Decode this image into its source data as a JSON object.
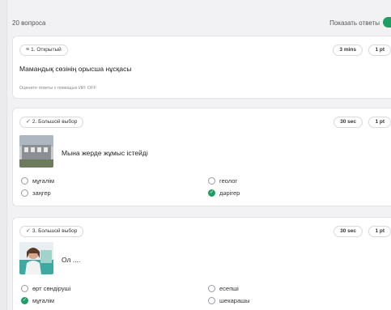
{
  "header": {
    "question_count": "20 вопроса",
    "show_answers_label": "Показать ответы",
    "show_answers_on": true
  },
  "questions": [
    {
      "number_type": "1. Открытый",
      "type_icon": "open-text-icon",
      "time": "3 mins",
      "points": "1 pt",
      "text": "Мамандық сөзінің орысша нұсқасы",
      "ai_note": "Оцените ответы с помощью ИИ: OFF"
    },
    {
      "number_type": "2. Большой выбор",
      "type_icon": "checkmark-icon",
      "time": "30 sec",
      "points": "1 pt",
      "text": "Мына жерде жұмыс істейді",
      "options": [
        {
          "label": "мұғалім",
          "correct": false
        },
        {
          "label": "геолог",
          "correct": false
        },
        {
          "label": "заңгер",
          "correct": false
        },
        {
          "label": "дәрігер",
          "correct": true
        }
      ]
    },
    {
      "number_type": "3. Большой выбор",
      "type_icon": "checkmark-icon",
      "time": "30 sec",
      "points": "1 pt",
      "text": "Ол ....",
      "options": [
        {
          "label": "өрт сөндіруші",
          "correct": false
        },
        {
          "label": "есепші",
          "correct": false
        },
        {
          "label": "мұғалім",
          "correct": true
        },
        {
          "label": "шекарашы",
          "correct": false
        }
      ]
    }
  ],
  "colors": {
    "accent_green": "#1e9e62",
    "background": "#f2f2f4",
    "card": "#ffffff"
  }
}
